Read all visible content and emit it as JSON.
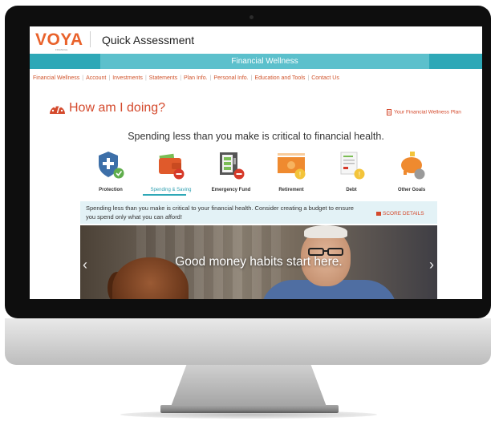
{
  "header": {
    "logo": "VOYA",
    "logo_sub": "FINANCIAL",
    "title": "Quick Assessment"
  },
  "banner": {
    "label": "Financial Wellness"
  },
  "nav": [
    "Financial Wellness",
    "Account",
    "Investments",
    "Statements",
    "Plan Info.",
    "Personal Info.",
    "Education and Tools",
    "Contact Us"
  ],
  "nav_separator": "|",
  "section": {
    "title": "How am I doing?",
    "plan_link": "Your Financial Wellness Plan"
  },
  "headline": "Spending less than you make is critical to financial health.",
  "categories": [
    {
      "label": "Protection",
      "icon": "shield-icon",
      "status": "check"
    },
    {
      "label": "Spending & Saving",
      "icon": "wallet-icon",
      "status": "minus",
      "active": true
    },
    {
      "label": "Emergency Fund",
      "icon": "safe-icon",
      "status": "minus"
    },
    {
      "label": "Retirement",
      "icon": "cash-icon",
      "status": "alert"
    },
    {
      "label": "Debt",
      "icon": "bill-icon",
      "status": "alert"
    },
    {
      "label": "Other Goals",
      "icon": "piggy-bank-icon",
      "status": "pending"
    }
  ],
  "info": {
    "text": "Spending less than you make is critical to your financial health. Consider creating a budget to ensure you spend only what you can afford!",
    "score_link": "SCORE DETAILS"
  },
  "hero": {
    "text": "Good money habits start here.",
    "prev": "‹",
    "next": "›"
  },
  "colors": {
    "brand_orange": "#e9622b",
    "teal": "#2ea8b7",
    "link_red": "#d4492c"
  }
}
